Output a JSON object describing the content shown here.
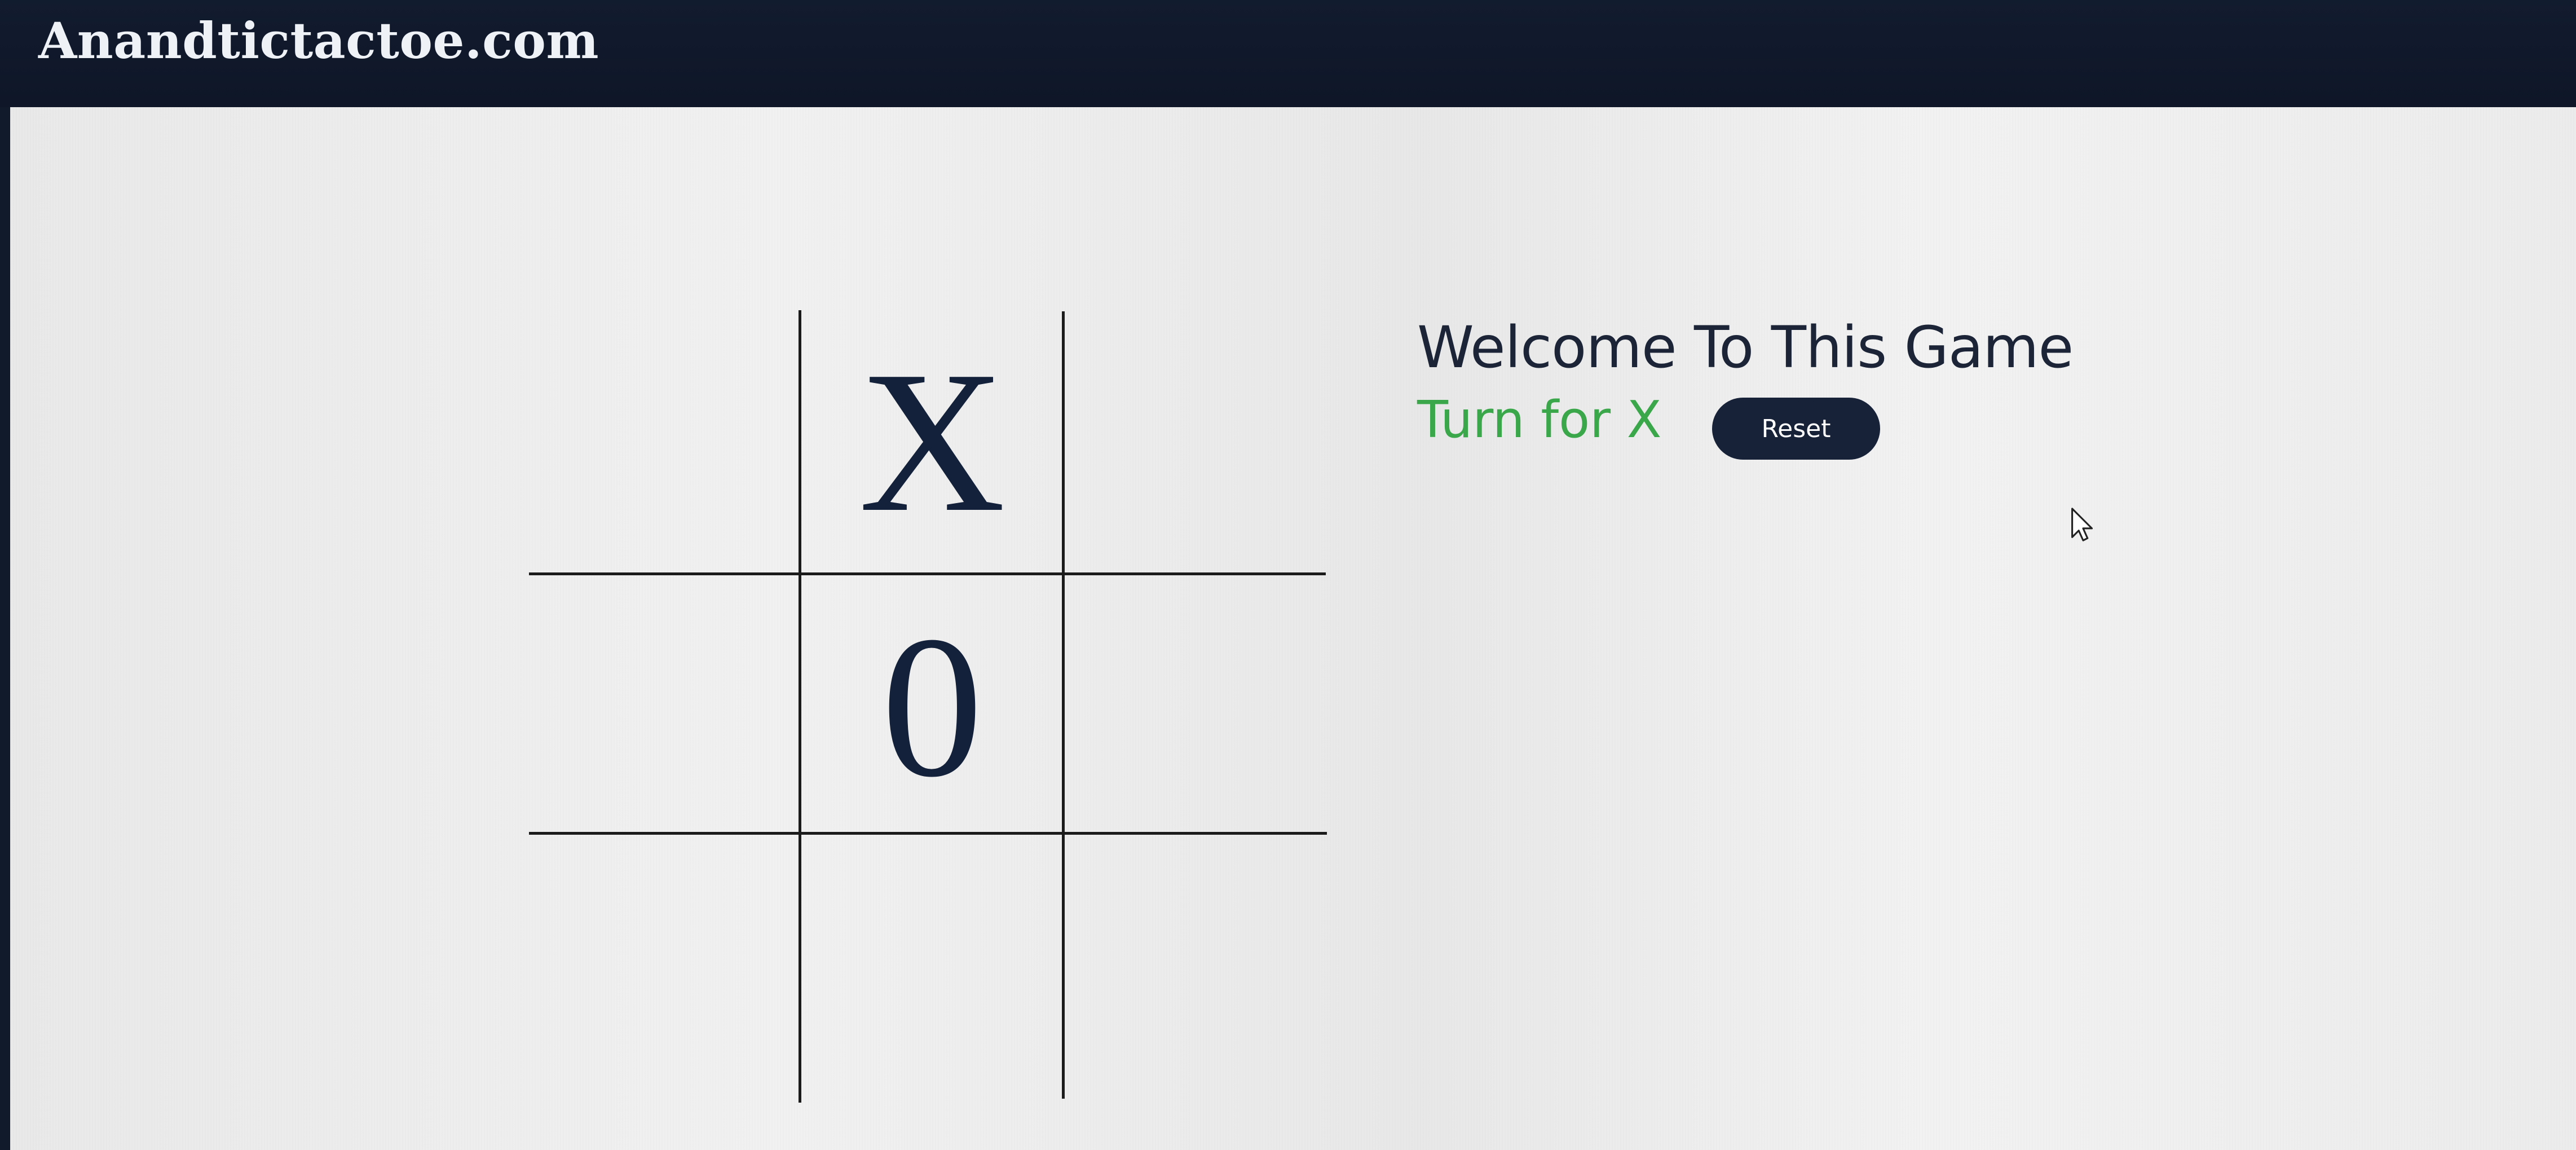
{
  "header": {
    "site_title": "Anandtictactoe.com"
  },
  "board": {
    "cells": [
      "",
      "X",
      "",
      "",
      "0",
      "",
      "",
      "",
      ""
    ]
  },
  "panel": {
    "heading": "Welcome To This Game",
    "status": "Turn for X",
    "reset_label": "Reset"
  },
  "colors": {
    "navbar": "#111a2b",
    "status_text": "#3aa84a",
    "button_bg": "#172238",
    "mark_color": "#14213a"
  }
}
